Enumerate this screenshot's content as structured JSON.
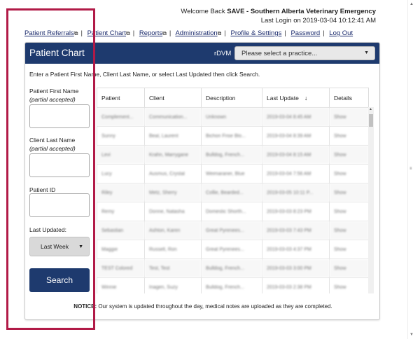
{
  "header": {
    "welcome_prefix": "Welcome Back ",
    "welcome_org": "SAVE - Southern Alberta Veterinary Emergency",
    "last_login": "Last Login on 2019-03-04 10:12:41 AM"
  },
  "nav": [
    {
      "label": "Patient Referrals",
      "external": true
    },
    {
      "label": "Patient Chart",
      "external": true
    },
    {
      "label": "Reports",
      "external": true
    },
    {
      "label": "Administration",
      "external": true
    },
    {
      "label": "Profile & Settings",
      "external": false
    },
    {
      "label": "Password",
      "external": false
    },
    {
      "label": "Log Out",
      "external": false
    }
  ],
  "panel": {
    "title": "Patient Chart",
    "rdvm_label": "rDVM",
    "practice_select": "Please select a practice...",
    "instructions": "Enter a Patient First Name, Client Last Name, or select Last Updated then click Search."
  },
  "form": {
    "first_name_label": "Patient First Name",
    "first_name_hint": "(partial accepted)",
    "first_name_value": "",
    "last_name_label": "Client Last Name",
    "last_name_hint": "(partial accepted)",
    "last_name_value": "",
    "patient_id_label": "Patient ID",
    "patient_id_value": "",
    "last_updated_label": "Last Updated:",
    "last_updated_value": "Last Week",
    "search_button": "Search"
  },
  "table": {
    "columns": [
      "Patient",
      "Client",
      "Description",
      "Last Update",
      "Details"
    ],
    "sort_indicator": "↓",
    "rows": [
      [
        "Complement...",
        "Communication...",
        "Unknown",
        "2019-03-04 8:45 AM",
        "Show"
      ],
      [
        "Sunny",
        "Beal, Laurent",
        "Bichon Frise Blo...",
        "2019-03-04 8:39 AM",
        "Show"
      ],
      [
        "Levi",
        "Krahn, Marrygane",
        "Bulldog, French...",
        "2019-03-04 8:15 AM",
        "Show"
      ],
      [
        "Lucy",
        "Ausmus, Crystal",
        "Weimaraner, Blue",
        "2019-03-04 7:56 AM",
        "Show"
      ],
      [
        "Riley",
        "Metz, Sherry",
        "Collie, Bearded...",
        "2019-03-05 10:11 P...",
        "Show"
      ],
      [
        "Remy",
        "Donne, Natasha",
        "Domestic Shorth...",
        "2019-03-03 8:23 PM",
        "Show"
      ],
      [
        "Sebastian",
        "Ashton, Karen",
        "Great Pyrenees...",
        "2019-03-03 7:43 PM",
        "Show"
      ],
      [
        "Maggie",
        "Russell, Ron",
        "Great Pyrenees...",
        "2019-03-03 4:37 PM",
        "Show"
      ],
      [
        "TEST Colored",
        "Test, Test",
        "Bulldog, French...",
        "2019-03-03 3:00 PM",
        "Show"
      ],
      [
        "Winnie",
        "Inagen, Suzy",
        "Bulldog, French...",
        "2019-03-03 2:38 PM",
        "Show"
      ]
    ]
  },
  "notice": {
    "bold": "NOTICE:",
    "text": " Our system is updated throughout the day, medical notes are uploaded as they are completed."
  },
  "colors": {
    "header_blue": "#1e3a6e",
    "highlight": "#b11a47",
    "link": "#1a2a6c"
  }
}
